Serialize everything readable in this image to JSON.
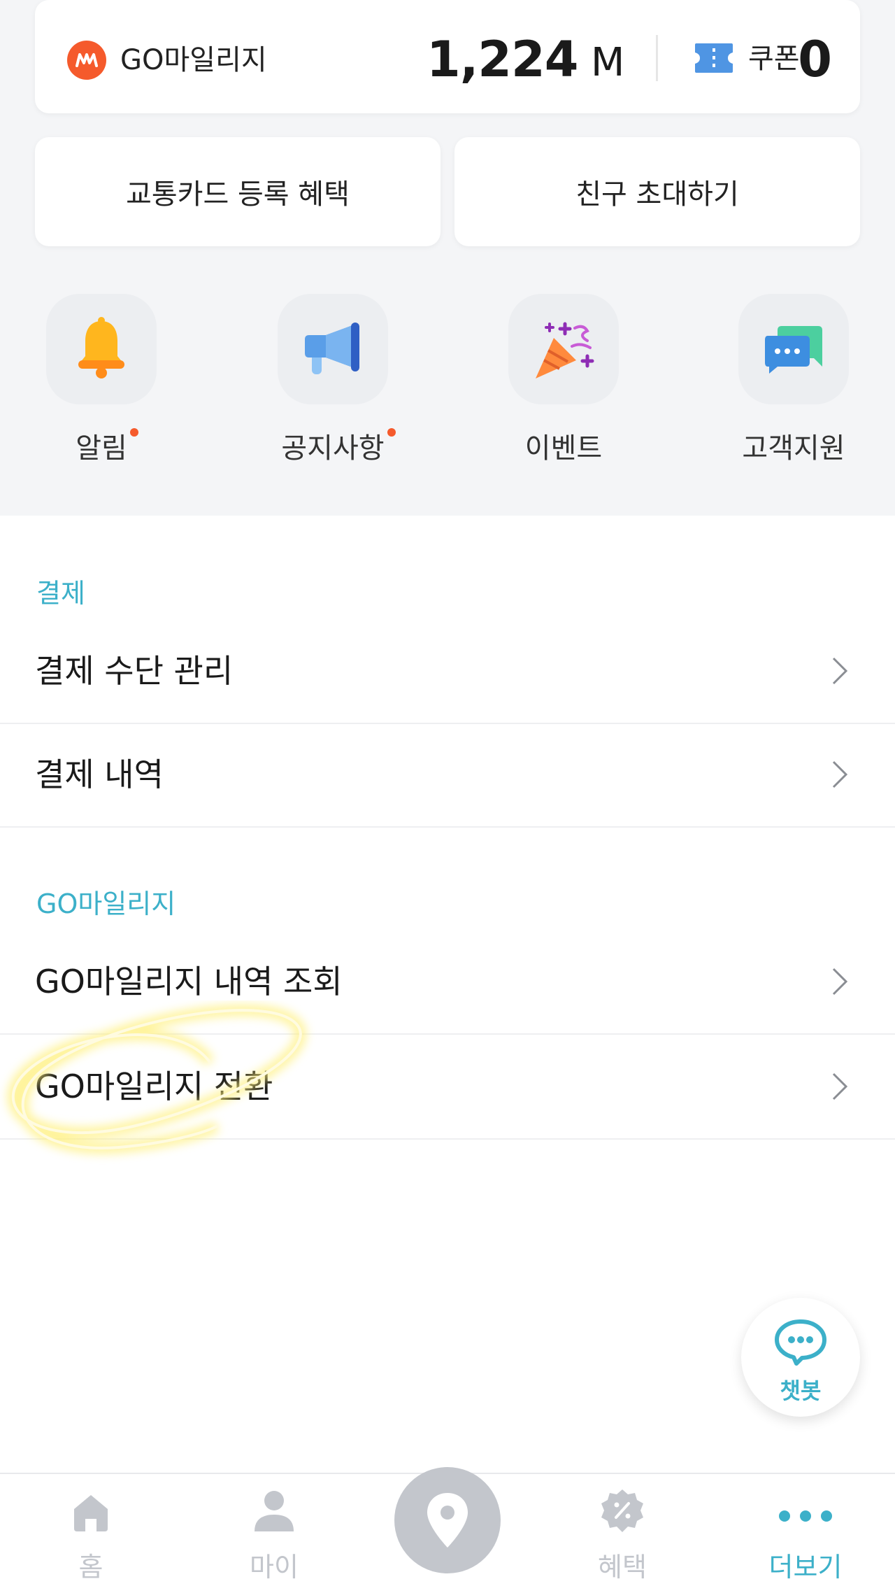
{
  "mileage": {
    "label": "GO마일리지",
    "value": "1,224",
    "unit": "M",
    "coupon_label": "쿠폰",
    "coupon_count": "0"
  },
  "buttons": {
    "transit_card": "교통카드 등록 혜택",
    "invite_friend": "친구 초대하기"
  },
  "shortcuts": [
    {
      "label": "알림",
      "icon": "bell-icon",
      "has_dot": true
    },
    {
      "label": "공지사항",
      "icon": "megaphone-icon",
      "has_dot": true
    },
    {
      "label": "이벤트",
      "icon": "party-popper-icon",
      "has_dot": false
    },
    {
      "label": "고객지원",
      "icon": "chat-bubbles-icon",
      "has_dot": false
    }
  ],
  "sections": [
    {
      "title": "결제",
      "items": [
        "결제 수단 관리",
        "결제 내역"
      ]
    },
    {
      "title": "GO마일리지",
      "items": [
        "GO마일리지 내역 조회",
        "GO마일리지 전환"
      ]
    }
  ],
  "chatbot": {
    "label": "챗봇"
  },
  "bottom_nav": {
    "items": [
      {
        "label": "홈",
        "icon": "home-icon",
        "active": false
      },
      {
        "label": "마이",
        "icon": "person-icon",
        "active": false
      },
      {
        "label": "",
        "icon": "location-pin-icon",
        "active": false
      },
      {
        "label": "혜택",
        "icon": "discount-badge-icon",
        "active": false
      },
      {
        "label": "더보기",
        "icon": "more-dots-icon",
        "active": true
      }
    ]
  },
  "colors": {
    "accent": "#3cb0c9",
    "brand_orange": "#f55a2c",
    "inactive": "#c3c6cc",
    "highlight": "#fff07a"
  }
}
